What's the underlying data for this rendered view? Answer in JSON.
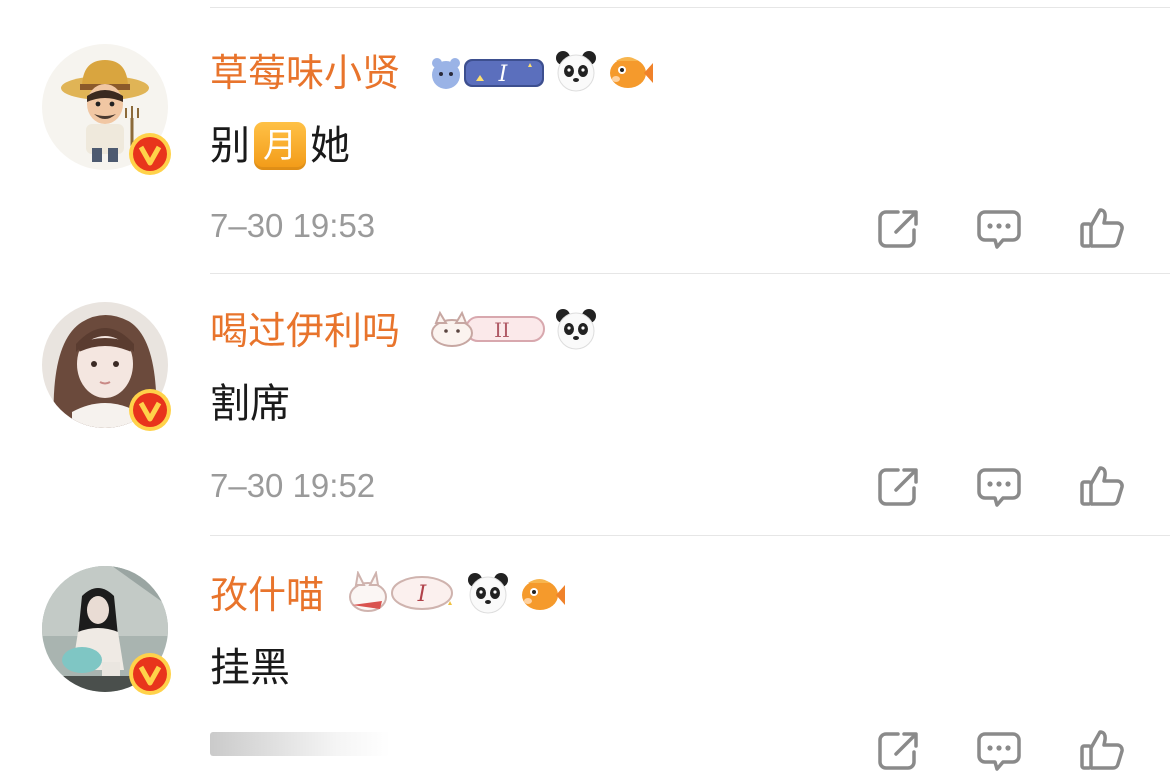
{
  "comments": [
    {
      "username": "草莓味小贤",
      "content_before": "别",
      "content_emoji": "月",
      "content_after": "她",
      "timestamp": "7–30 19:53",
      "level_badge": "I",
      "badges": [
        "level-bear-badge",
        "panda-icon",
        "fish-icon"
      ]
    },
    {
      "username": "喝过伊利吗",
      "content_before": "割席",
      "content_emoji": "",
      "content_after": "",
      "timestamp": "7–30 19:52",
      "level_badge": "II",
      "badges": [
        "level-cat-badge",
        "panda-icon"
      ]
    },
    {
      "username": "孜什喵",
      "content_before": "挂黑",
      "content_emoji": "",
      "content_after": "",
      "timestamp": "",
      "level_badge": "I",
      "badges": [
        "level-rabbit-badge",
        "panda-icon",
        "fish-icon"
      ]
    }
  ],
  "colors": {
    "username": "#e8742c",
    "text": "#1a1a1a",
    "timestamp": "#9a9a9a",
    "icon": "#8a8a8a",
    "verified_badge": "#e8341c",
    "verified_ring": "#ffd24a"
  },
  "icons": {
    "share": "share-icon",
    "comment": "comment-icon",
    "like": "like-icon",
    "verified": "verified-v-icon"
  }
}
